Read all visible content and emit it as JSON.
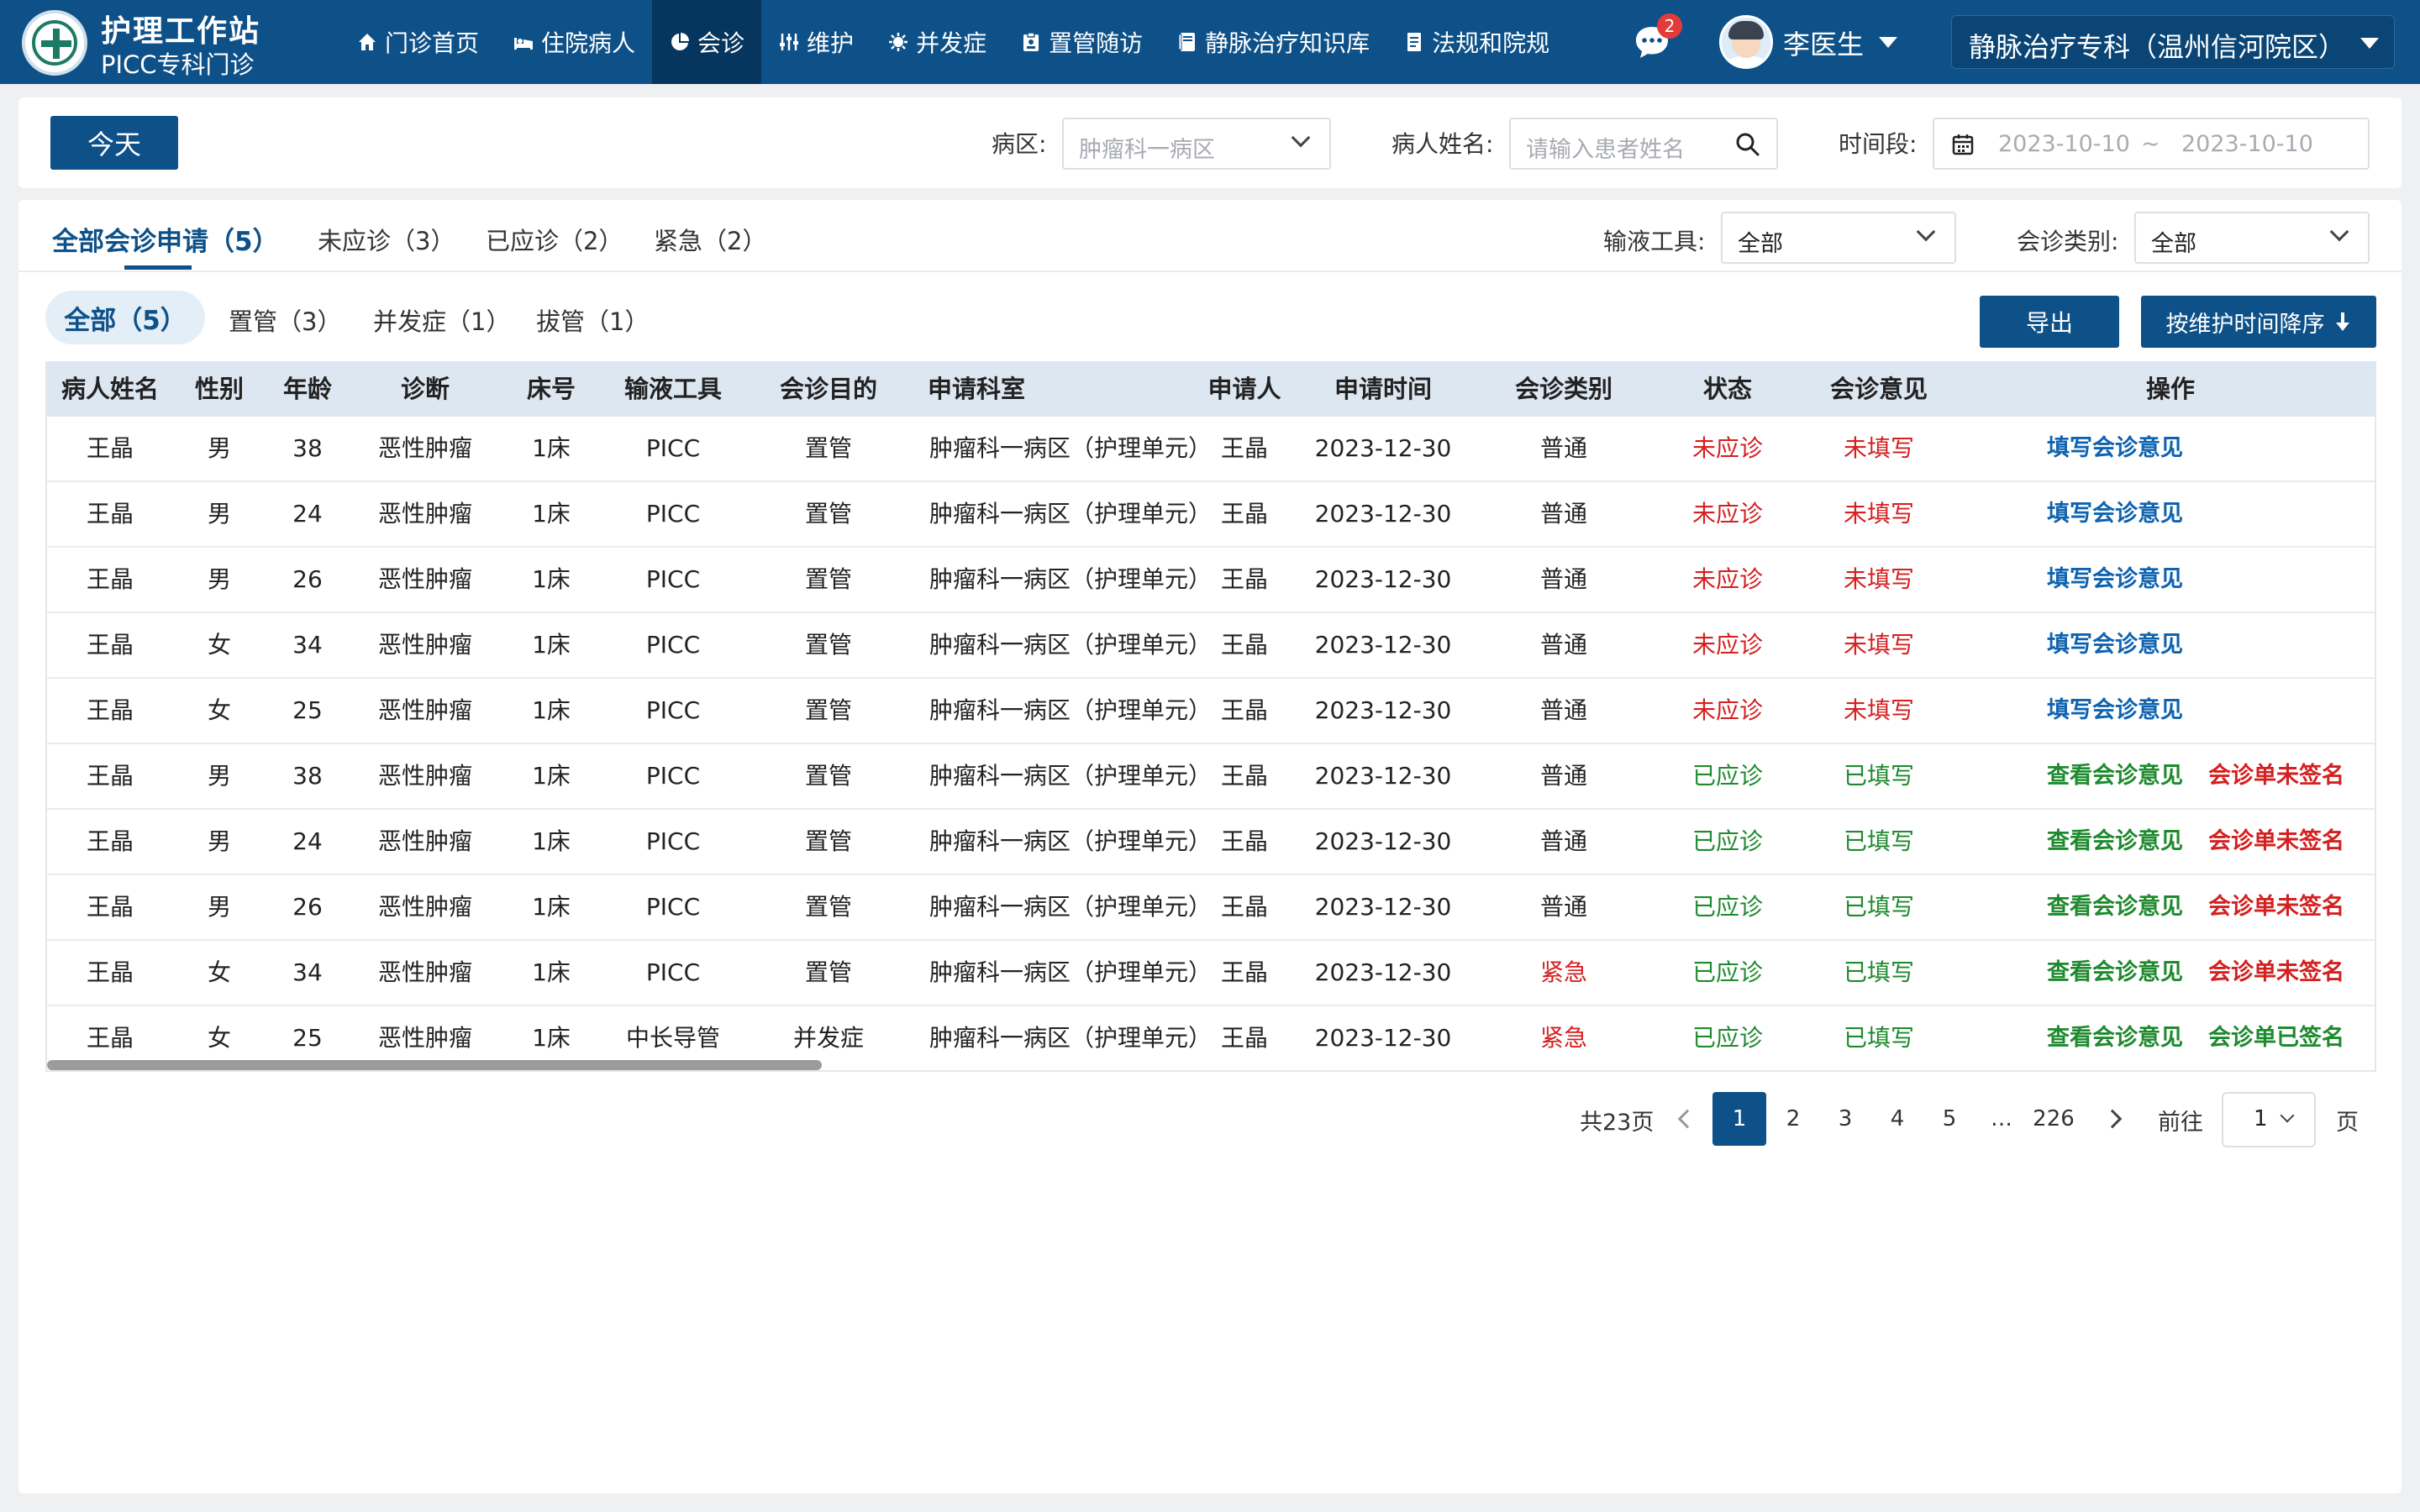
{
  "header": {
    "title": "护理工作站",
    "subtitle": "PICC专科门诊",
    "nav": [
      {
        "label": "门诊首页",
        "icon": "home-icon"
      },
      {
        "label": "住院病人",
        "icon": "bed-icon"
      },
      {
        "label": "会诊",
        "icon": "pie-chart-icon",
        "active": true
      },
      {
        "label": "维护",
        "icon": "sliders-icon"
      },
      {
        "label": "并发症",
        "icon": "virus-icon"
      },
      {
        "label": "置管随访",
        "icon": "clipboard-icon"
      },
      {
        "label": "静脉治疗知识库",
        "icon": "book-icon"
      },
      {
        "label": "法规和院规",
        "icon": "document-icon"
      }
    ],
    "message_badge": "2",
    "user_name": "李医生",
    "site": "静脉治疗专科（温州信河院区）"
  },
  "filters": {
    "today_label": "今天",
    "ward_label": "病区:",
    "ward_placeholder": "肿瘤科一病区",
    "patient_label": "病人姓名:",
    "patient_placeholder": "请输入患者姓名",
    "time_label": "时间段:",
    "date_start": "2023-10-10",
    "date_sep": "~",
    "date_end": "2023-10-10"
  },
  "tabs": [
    {
      "label": "全部会诊申请（5）",
      "active": true
    },
    {
      "label": "未应诊（3）"
    },
    {
      "label": "已应诊（2）"
    },
    {
      "label": "紧急（2）"
    }
  ],
  "tool_filter": {
    "label": "输液工具:",
    "value": "全部"
  },
  "type_filter": {
    "label": "会诊类别:",
    "value": "全部"
  },
  "pills": [
    {
      "label": "全部（5）",
      "active": true
    },
    {
      "label": "置管（3）"
    },
    {
      "label": "并发症（1）"
    },
    {
      "label": "拔管（1）"
    }
  ],
  "actions": {
    "export": "导出",
    "sort": "按维护时间降序"
  },
  "table": {
    "columns": [
      "病人姓名",
      "性别",
      "年龄",
      "诊断",
      "床号",
      "输液工具",
      "会诊目的",
      "申请科室",
      "申请人",
      "申请时间",
      "会诊类别",
      "状态",
      "会诊意见",
      "操作"
    ],
    "rows": [
      {
        "name": "王晶",
        "gender": "男",
        "age": "38",
        "diag": "恶性肿瘤",
        "bed": "1床",
        "tool": "PICC",
        "purpose": "置管",
        "dept": "肿瘤科一病区（护理单元）",
        "applicant": "王晶",
        "time": "2023-12-30",
        "type": "普通",
        "type_color": "normal",
        "status": "未应诊",
        "status_color": "red",
        "opinion": "未填写",
        "opinion_color": "red",
        "op1": "填写会诊意见",
        "op1_color": "blue",
        "op2": "",
        "op2_color": "red"
      },
      {
        "name": "王晶",
        "gender": "男",
        "age": "24",
        "diag": "恶性肿瘤",
        "bed": "1床",
        "tool": "PICC",
        "purpose": "置管",
        "dept": "肿瘤科一病区（护理单元）",
        "applicant": "王晶",
        "time": "2023-12-30",
        "type": "普通",
        "type_color": "normal",
        "status": "未应诊",
        "status_color": "red",
        "opinion": "未填写",
        "opinion_color": "red",
        "op1": "填写会诊意见",
        "op1_color": "blue",
        "op2": "",
        "op2_color": "red"
      },
      {
        "name": "王晶",
        "gender": "男",
        "age": "26",
        "diag": "恶性肿瘤",
        "bed": "1床",
        "tool": "PICC",
        "purpose": "置管",
        "dept": "肿瘤科一病区（护理单元）",
        "applicant": "王晶",
        "time": "2023-12-30",
        "type": "普通",
        "type_color": "normal",
        "status": "未应诊",
        "status_color": "red",
        "opinion": "未填写",
        "opinion_color": "red",
        "op1": "填写会诊意见",
        "op1_color": "blue",
        "op2": "",
        "op2_color": "red"
      },
      {
        "name": "王晶",
        "gender": "女",
        "age": "34",
        "diag": "恶性肿瘤",
        "bed": "1床",
        "tool": "PICC",
        "purpose": "置管",
        "dept": "肿瘤科一病区（护理单元）",
        "applicant": "王晶",
        "time": "2023-12-30",
        "type": "普通",
        "type_color": "normal",
        "status": "未应诊",
        "status_color": "red",
        "opinion": "未填写",
        "opinion_color": "red",
        "op1": "填写会诊意见",
        "op1_color": "blue",
        "op2": "",
        "op2_color": "red"
      },
      {
        "name": "王晶",
        "gender": "女",
        "age": "25",
        "diag": "恶性肿瘤",
        "bed": "1床",
        "tool": "PICC",
        "purpose": "置管",
        "dept": "肿瘤科一病区（护理单元）",
        "applicant": "王晶",
        "time": "2023-12-30",
        "type": "普通",
        "type_color": "normal",
        "status": "未应诊",
        "status_color": "red",
        "opinion": "未填写",
        "opinion_color": "red",
        "op1": "填写会诊意见",
        "op1_color": "blue",
        "op2": "",
        "op2_color": "red"
      },
      {
        "name": "王晶",
        "gender": "男",
        "age": "38",
        "diag": "恶性肿瘤",
        "bed": "1床",
        "tool": "PICC",
        "purpose": "置管",
        "dept": "肿瘤科一病区（护理单元）",
        "applicant": "王晶",
        "time": "2023-12-30",
        "type": "普通",
        "type_color": "normal",
        "status": "已应诊",
        "status_color": "green",
        "opinion": "已填写",
        "opinion_color": "green",
        "op1": "查看会诊意见",
        "op1_color": "green",
        "op2": "会诊单未签名",
        "op2_color": "red"
      },
      {
        "name": "王晶",
        "gender": "男",
        "age": "24",
        "diag": "恶性肿瘤",
        "bed": "1床",
        "tool": "PICC",
        "purpose": "置管",
        "dept": "肿瘤科一病区（护理单元）",
        "applicant": "王晶",
        "time": "2023-12-30",
        "type": "普通",
        "type_color": "normal",
        "status": "已应诊",
        "status_color": "green",
        "opinion": "已填写",
        "opinion_color": "green",
        "op1": "查看会诊意见",
        "op1_color": "green",
        "op2": "会诊单未签名",
        "op2_color": "red"
      },
      {
        "name": "王晶",
        "gender": "男",
        "age": "26",
        "diag": "恶性肿瘤",
        "bed": "1床",
        "tool": "PICC",
        "purpose": "置管",
        "dept": "肿瘤科一病区（护理单元）",
        "applicant": "王晶",
        "time": "2023-12-30",
        "type": "普通",
        "type_color": "normal",
        "status": "已应诊",
        "status_color": "green",
        "opinion": "已填写",
        "opinion_color": "green",
        "op1": "查看会诊意见",
        "op1_color": "green",
        "op2": "会诊单未签名",
        "op2_color": "red"
      },
      {
        "name": "王晶",
        "gender": "女",
        "age": "34",
        "diag": "恶性肿瘤",
        "bed": "1床",
        "tool": "PICC",
        "purpose": "置管",
        "dept": "肿瘤科一病区（护理单元）",
        "applicant": "王晶",
        "time": "2023-12-30",
        "type": "紧急",
        "type_color": "red",
        "status": "已应诊",
        "status_color": "green",
        "opinion": "已填写",
        "opinion_color": "green",
        "op1": "查看会诊意见",
        "op1_color": "green",
        "op2": "会诊单未签名",
        "op2_color": "red"
      },
      {
        "name": "王晶",
        "gender": "女",
        "age": "25",
        "diag": "恶性肿瘤",
        "bed": "1床",
        "tool": "中长导管",
        "purpose": "并发症",
        "dept": "肿瘤科一病区（护理单元）",
        "applicant": "王晶",
        "time": "2023-12-30",
        "type": "紧急",
        "type_color": "red",
        "status": "已应诊",
        "status_color": "green",
        "opinion": "已填写",
        "opinion_color": "green",
        "op1": "查看会诊意见",
        "op1_color": "green",
        "op2": "会诊单已签名",
        "op2_color": "green"
      }
    ]
  },
  "pagination": {
    "total": "共23页",
    "pages": [
      "1",
      "2",
      "3",
      "4",
      "5",
      "…",
      "226"
    ],
    "current": "1",
    "goto_label": "前往",
    "goto_value": "1",
    "page_suffix": "页"
  },
  "colors": {
    "primary": "#0e5188",
    "red": "#d42020",
    "green": "#1e8a2e",
    "link_blue": "#0e63b0"
  }
}
